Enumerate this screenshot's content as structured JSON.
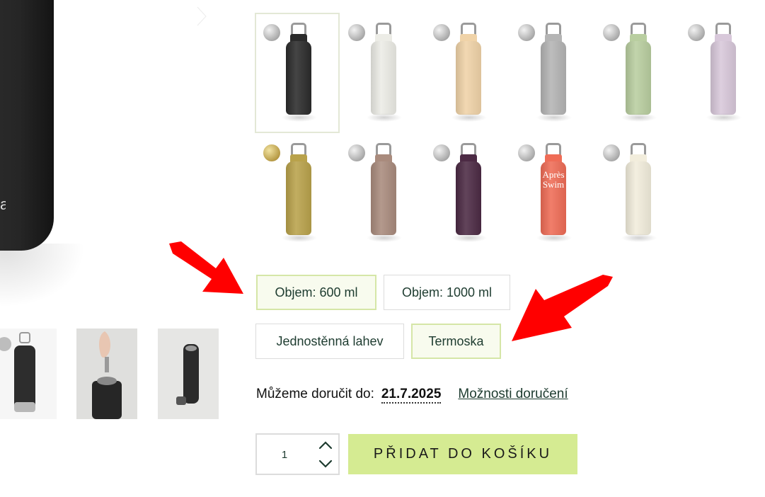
{
  "gallery": {
    "main_logo_text": "a",
    "next_icon": "chevron-right-icon"
  },
  "colors": {
    "accent": "#d5eb92",
    "selected_border": "#d5e6a7",
    "text_dark_green": "#1d3b2f",
    "annotation_red": "#ff0000"
  },
  "swatches": [
    {
      "color": "#2b2b2b",
      "badge": "silver",
      "active": true
    },
    {
      "color": "#ecece6",
      "badge": "silver"
    },
    {
      "color": "#f0d3a8",
      "badge": "silver"
    },
    {
      "color": "#b4b4b4",
      "badge": "silver"
    },
    {
      "color": "#b9cea0",
      "badge": "silver"
    },
    {
      "color": "#d8c8da",
      "badge": "silver"
    },
    {
      "color": "#b9a24b",
      "badge": "gold"
    },
    {
      "color": "#a98b7d",
      "badge": "silver"
    },
    {
      "color": "#4c2a44",
      "badge": "silver"
    },
    {
      "color": "#ef6c56",
      "badge": "silver",
      "print": "Après Swim"
    },
    {
      "color": "#f2eddc",
      "badge": "silver"
    }
  ],
  "volume_options": [
    {
      "label": "Objem: 600 ml",
      "selected": true
    },
    {
      "label": "Objem: 1000 ml",
      "selected": false
    }
  ],
  "type_options": [
    {
      "label": "Jednostěnná lahev",
      "selected": false
    },
    {
      "label": "Termoska",
      "selected": true
    }
  ],
  "delivery": {
    "label": "Můžeme doručit do:",
    "date": "21.7.2025",
    "link": "Možnosti doručení"
  },
  "cart": {
    "quantity": "1",
    "add_button": "PŘIDAT DO KOŠÍKU"
  }
}
